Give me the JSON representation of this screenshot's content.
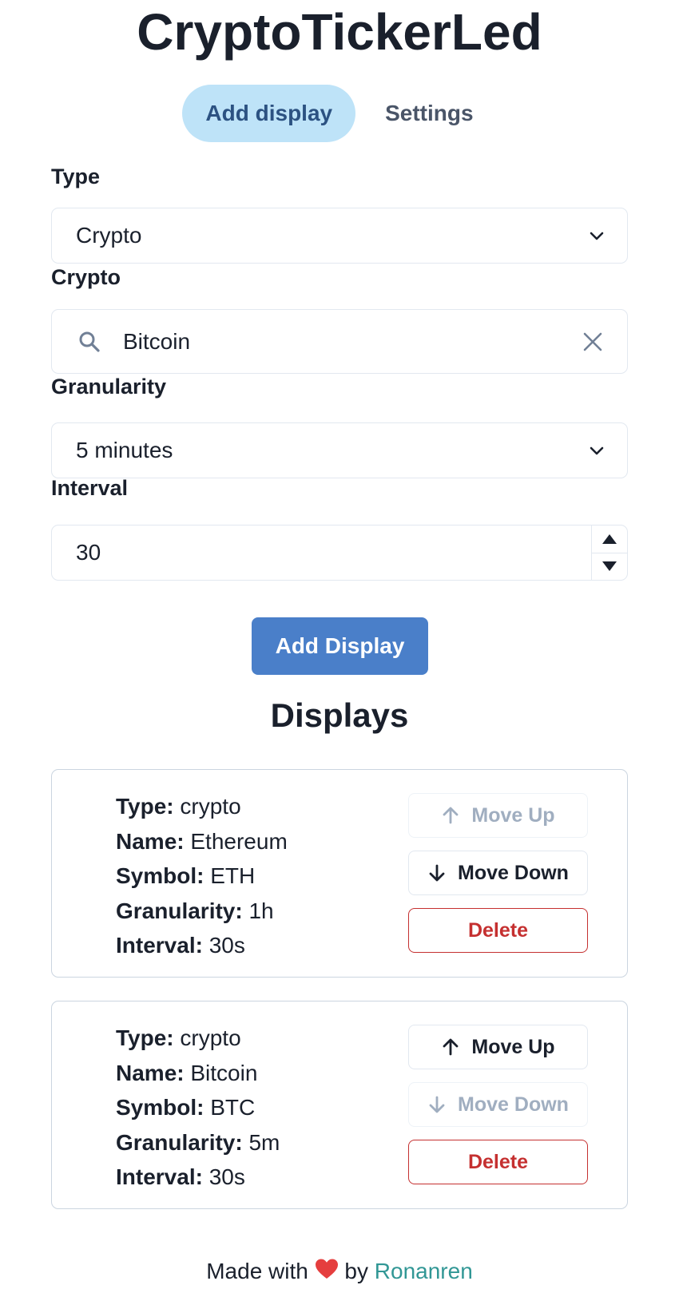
{
  "app": {
    "title": "CryptoTickerLed"
  },
  "tabs": [
    {
      "label": "Add display",
      "active": true
    },
    {
      "label": "Settings",
      "active": false
    }
  ],
  "form": {
    "type": {
      "label": "Type",
      "value": "Crypto"
    },
    "crypto": {
      "label": "Crypto",
      "value": "Bitcoin"
    },
    "granularity": {
      "label": "Granularity",
      "value": "5 minutes"
    },
    "interval": {
      "label": "Interval",
      "value": "30"
    },
    "submit_label": "Add Display"
  },
  "displays": {
    "title": "Displays",
    "items": [
      {
        "type_label": "Type:",
        "type": "crypto",
        "name_label": "Name:",
        "name": "Ethereum",
        "symbol_label": "Symbol:",
        "symbol": "ETH",
        "granularity_label": "Granularity:",
        "granularity": "1h",
        "interval_label": "Interval:",
        "interval": "30s",
        "move_up_label": "Move Up",
        "move_up_disabled": true,
        "move_down_label": "Move Down",
        "move_down_disabled": false,
        "delete_label": "Delete"
      },
      {
        "type_label": "Type:",
        "type": "crypto",
        "name_label": "Name:",
        "name": "Bitcoin",
        "symbol_label": "Symbol:",
        "symbol": "BTC",
        "granularity_label": "Granularity:",
        "granularity": "5m",
        "interval_label": "Interval:",
        "interval": "30s",
        "move_up_label": "Move Up",
        "move_up_disabled": false,
        "move_down_label": "Move Down",
        "move_down_disabled": true,
        "delete_label": "Delete"
      }
    ]
  },
  "footer": {
    "prefix": "Made with",
    "heart_icon": "red-heart",
    "by": "by",
    "author": "Ronanren"
  },
  "colors": {
    "primary": "#4a7fc9",
    "tab_active_bg": "#bee3f8",
    "danger": "#c53030",
    "link": "#319795"
  }
}
